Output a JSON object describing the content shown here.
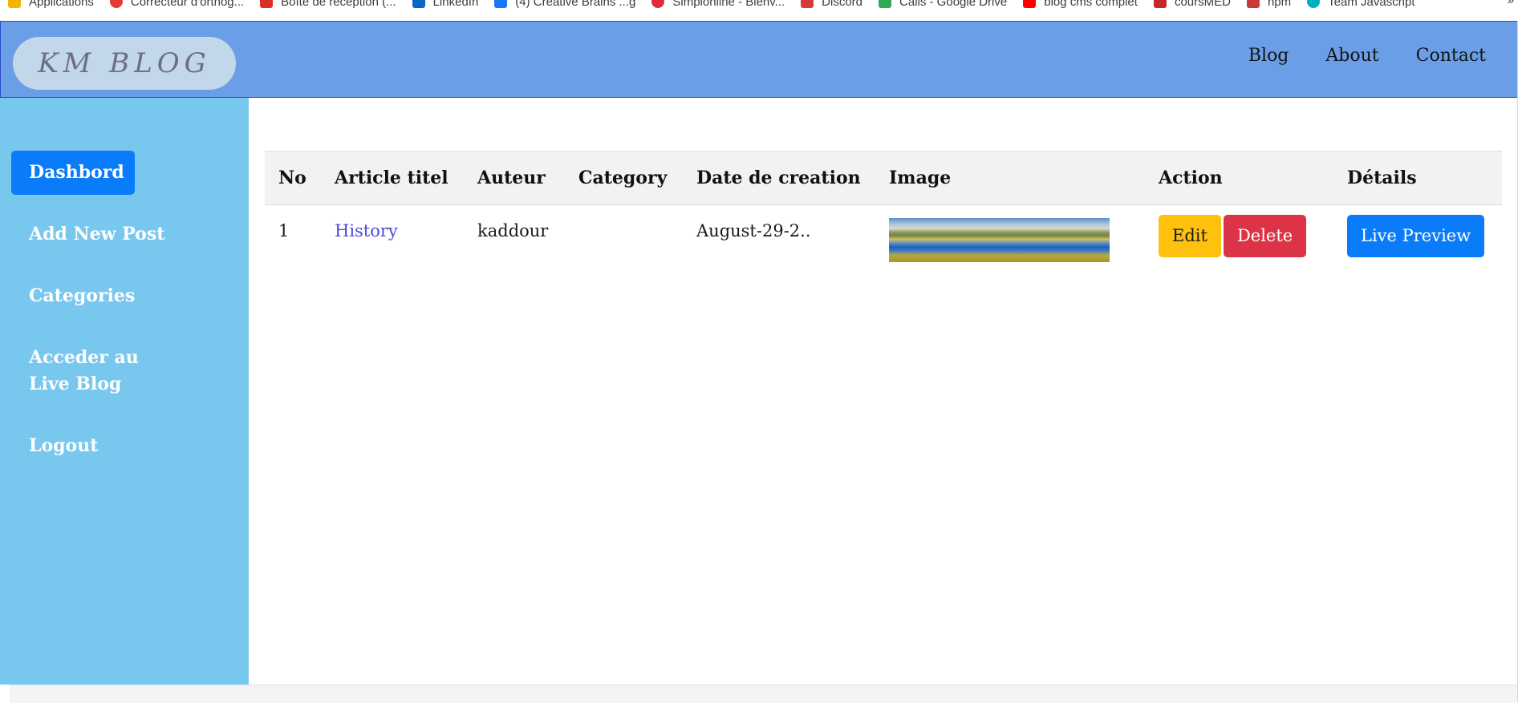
{
  "bookmarks": [
    {
      "label": "Applications",
      "icon": "apps-grid-icon",
      "color": "#f4b400"
    },
    {
      "label": "Correcteur d'orthog...",
      "icon": "spellcheck-icon",
      "color": "#e53935"
    },
    {
      "label": "Boîte de réception (...",
      "icon": "inbox-icon",
      "color": "#d93025"
    },
    {
      "label": "LinkedIn",
      "icon": "linkedin-icon",
      "color": "#0a66c2"
    },
    {
      "label": "(4) Creative Brains ...g",
      "icon": "facebook-icon",
      "color": "#1877f2"
    },
    {
      "label": "Simplonline - Bienv...",
      "icon": "simplon-icon",
      "color": "#e02c3b"
    },
    {
      "label": "Discord",
      "icon": "discord-icon",
      "color": "#d83a3a"
    },
    {
      "label": "Calls - Google Drive",
      "icon": "google-drive-icon",
      "color": "#34a853"
    },
    {
      "label": "blog cms complet",
      "icon": "youtube-icon",
      "color": "#ff0000"
    },
    {
      "label": "coursMED",
      "icon": "course-icon",
      "color": "#c62828"
    },
    {
      "label": "npm",
      "icon": "npm-icon",
      "color": "#cb3837"
    },
    {
      "label": "Team Javascript",
      "icon": "team-icon",
      "color": "#00acc1"
    }
  ],
  "bookmarks_more": "»",
  "header": {
    "brand": "KM BLOG",
    "nav": [
      "Blog",
      "About",
      "Contact"
    ]
  },
  "sidebar": {
    "items": [
      {
        "label": "Dashbord",
        "active": true
      },
      {
        "label": "Add New Post",
        "active": false
      },
      {
        "label": "Categories",
        "active": false
      },
      {
        "label": "Acceder au Live Blog",
        "active": false
      },
      {
        "label": "Logout",
        "active": false
      }
    ]
  },
  "table": {
    "headers": [
      "No",
      "Article titel",
      "Auteur",
      "Category",
      "Date de creation",
      "Image",
      "Action",
      "Détails"
    ],
    "rows": [
      {
        "no": "1",
        "title": "History",
        "author": "kaddour",
        "category": "",
        "date": "August-29-2..",
        "image": "landscape-thumbnail",
        "edit_label": "Edit",
        "delete_label": "Delete",
        "details_label": "Live Preview"
      }
    ]
  },
  "colors": {
    "header_bg": "#6a9ee6",
    "sidebar_bg": "#78c7ef",
    "active_item": "#0b7cf9",
    "edit_btn": "#fdc10e",
    "delete_btn": "#dc3446",
    "live_btn": "#0b7cf9"
  }
}
